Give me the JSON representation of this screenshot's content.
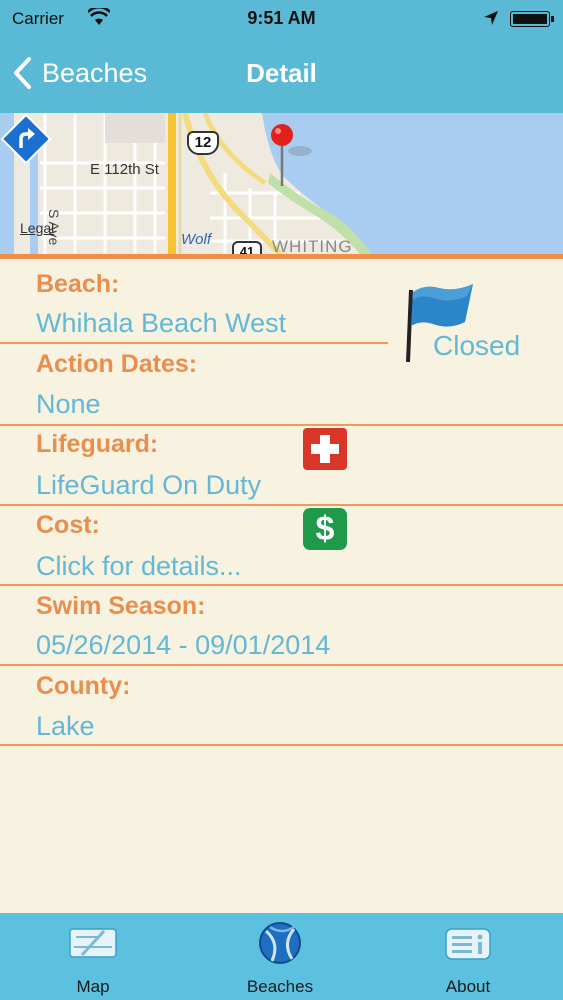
{
  "status_bar": {
    "carrier": "Carrier",
    "time": "9:51 AM"
  },
  "nav": {
    "back_label": "Beaches",
    "title": "Detail"
  },
  "map": {
    "legal": "Legal",
    "labels": {
      "route_shield": "12",
      "street": "E 112th St",
      "avenue": "S Ave",
      "wolf": "Wolf",
      "town": "WHITING",
      "shield2": "41"
    }
  },
  "beach": {
    "beach_label": "Beach:",
    "beach_value": "Whihala Beach West",
    "flag_status": "Closed",
    "flag_color": "#2a86c8",
    "action_label": "Action Dates:",
    "action_value": "None",
    "lifeguard_label": "Lifeguard:",
    "lifeguard_value": "LifeGuard On Duty",
    "cost_label": "Cost:",
    "cost_value": "Click for details...",
    "cost_icon_text": "$",
    "season_label": "Swim Season:",
    "season_value": "05/26/2014 - 09/01/2014",
    "county_label": "County:",
    "county_value": "Lake"
  },
  "tabs": [
    {
      "label": "Map",
      "icon": "map-icon"
    },
    {
      "label": "Beaches",
      "icon": "beach-ball-icon"
    },
    {
      "label": "About",
      "icon": "info-icon"
    }
  ],
  "colors": {
    "header": "#5ab9d4",
    "label": "#e88f4f",
    "value": "#62b8d6",
    "background": "#f8f2e1",
    "tabbar": "#5bc1df"
  }
}
